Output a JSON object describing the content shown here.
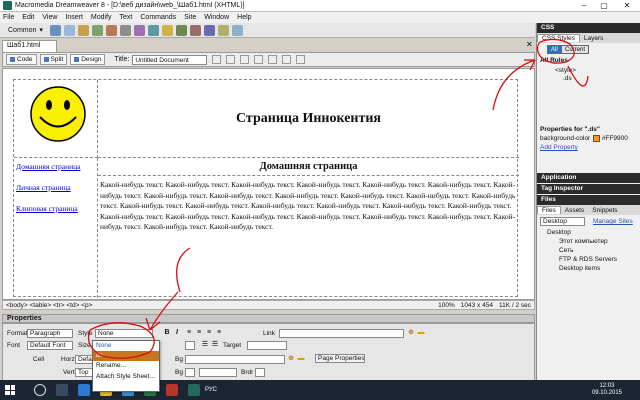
{
  "window": {
    "title": "Macromedia Dreamweaver 8 - [D:\\веб дизайн\\web_\\Шаб1.html (XHTML)]",
    "minimize": "–",
    "maximize": "▢",
    "close": "✕"
  },
  "menu": [
    "File",
    "Edit",
    "View",
    "Insert",
    "Modify",
    "Text",
    "Commands",
    "Site",
    "Window",
    "Help"
  ],
  "toolbar": {
    "insert_category": "Common"
  },
  "document": {
    "tab_label": "Шаб1.html",
    "views": {
      "code": "Code",
      "split": "Split",
      "design": "Design"
    },
    "title_label": "Title:",
    "title_value": "Untitled Document"
  },
  "page": {
    "heading": "Страница Иннокентия",
    "nav": [
      "Домашняя страница",
      "Личная страница",
      "Клиповая страница"
    ],
    "content_heading": "Домашняя страница",
    "content_text": "Какой-нибудь текст. Какой-нибудь текст. Какой-нибудь текст. Какой-нибудь текст. Какой-нибудь текст. Какой-нибудь текст. Какой-нибудь текст. Какой-нибудь текст. Какой-нибудь текст. Какой-нибудь текст. Какой-нибудь текст. Какой-нибудь текст. Какой-нибудь текст. Какой-нибудь текст. Какой-нибудь текст. Какой-нибудь текст. Какой-нибудь текст. Какой-нибудь текст. Какой-нибудь текст. Какой-нибудь текст. Какой-нибудь текст. Какой-нибудь текст. Какой-нибудь текст. Какой-нибудь текст. Какой-нибудь текст. Какой-нибудь текст. Какой-нибудь текст. Какой-нибудь текст."
  },
  "status": {
    "tag_path": "<body> <table> <tr> <td> <p>",
    "zoom": "100%",
    "size": "1043 x 454",
    "file_info": "11K / 2 sec"
  },
  "properties": {
    "header": "Properties",
    "format_label": "Format",
    "format_value": "Paragraph",
    "style_label": "Style",
    "style_value": "None",
    "link_label": "Link",
    "font_label": "Font",
    "font_value": "Default Font",
    "size_label": "Size",
    "target_label": "Target",
    "cell_label": "Cell",
    "horz_label": "Horz",
    "horz_value": "Default",
    "vert_label": "Vert",
    "vert_value": "Top",
    "no_wrap_label": "No wrap",
    "bg_label": "Bg",
    "brdr_label": "Brdr",
    "page_props_button": "Page Properties...",
    "style_options": [
      "None",
      "ds",
      "Rename...",
      "Attach Style Sheet..."
    ]
  },
  "css_panel": {
    "title": "CSS",
    "tabs": [
      "CSS Styles",
      "Layers"
    ],
    "buttons": [
      "All",
      "Current"
    ],
    "all_rules_label": "All Rules",
    "rules": [
      "<style>",
      ".ds"
    ],
    "props_title": "Properties for \".ds\"",
    "prop_name": "background-color",
    "prop_value": "#FF9900",
    "add_property": "Add Property",
    "accent": "#FF9900"
  },
  "collapsed_panels": [
    "Application",
    "Tag Inspector"
  ],
  "files_panel": {
    "title": "Files",
    "tabs": [
      "Files",
      "Assets",
      "Snippets"
    ],
    "site_value": "Desktop",
    "manage_sites": "Manage Sites",
    "tree": [
      "Desktop",
      "Этот компьютер",
      "Сеть",
      "FTP & RDS Servers",
      "Desktop items"
    ]
  },
  "taskbar": {
    "language": "РУС",
    "time": "12:03",
    "date": "09.10.2015"
  }
}
